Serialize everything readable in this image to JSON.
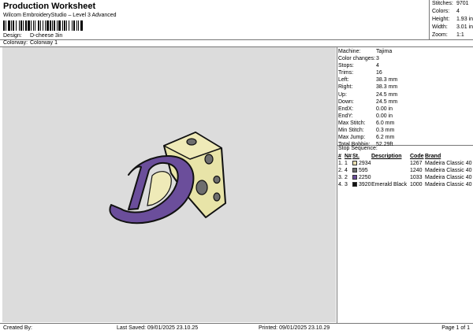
{
  "header": {
    "title": "Production Worksheet",
    "subtitle": "Wilcom EmbroideryStudio – Level 3 Advanced"
  },
  "design": [
    {
      "label": "Design:",
      "value": "D-cheese 3in"
    },
    {
      "label": "Colorway:",
      "value": "Colorway 1"
    }
  ],
  "stats": [
    {
      "label": "Stitches:",
      "value": "9701"
    },
    {
      "label": "Colors:",
      "value": "4"
    },
    {
      "label": "Height:",
      "value": "1.93 in"
    },
    {
      "label": "Width:",
      "value": "3.01 in"
    },
    {
      "label": "Zoom:",
      "value": "1:1"
    }
  ],
  "machine": [
    {
      "label": "Machine:",
      "value": "Tajima"
    },
    {
      "label": "Color changes:",
      "value": "3"
    },
    {
      "label": "Stops:",
      "value": "4"
    },
    {
      "label": "Trims:",
      "value": "16"
    },
    {
      "label": "Left:",
      "value": "38.3 mm"
    },
    {
      "label": "Right:",
      "value": "38.3 mm"
    },
    {
      "label": "Up:",
      "value": "24.5 mm"
    },
    {
      "label": "Down:",
      "value": "24.5 mm"
    },
    {
      "label": "EndX:",
      "value": "0.00 in"
    },
    {
      "label": "EndY:",
      "value": "0.00 in"
    },
    {
      "label": "Max Stitch:",
      "value": "6.0 mm"
    },
    {
      "label": "Min Stitch:",
      "value": "0.3 mm"
    },
    {
      "label": "Max Jump:",
      "value": "6.2 mm"
    },
    {
      "label": "Total Bobbin:",
      "value": "52.29ft"
    }
  ],
  "stop_sequence": {
    "title": "Stop Sequence:",
    "headers": [
      "#",
      "N#",
      "St.",
      "Description",
      "Code",
      "Brand"
    ],
    "rows": [
      {
        "num": "1.",
        "n": "1",
        "color": "#e8ddb0",
        "st": "2934",
        "desc": "",
        "code": "1267",
        "brand": "Madeira Classic 40"
      },
      {
        "num": "2.",
        "n": "4",
        "color": "#6e6e6e",
        "st": "595",
        "desc": "",
        "code": "1240",
        "brand": "Madeira Classic 40"
      },
      {
        "num": "3.",
        "n": "2",
        "color": "#6b4e9b",
        "st": "2250",
        "desc": "",
        "code": "1033",
        "brand": "Madeira Classic 40"
      },
      {
        "num": "4.",
        "n": "3",
        "color": "#111111",
        "st": "3920",
        "desc": "Emerald Black",
        "code": "1000",
        "brand": "Madeira Classic 40"
      }
    ]
  },
  "footer": {
    "created": "Created By:",
    "saved": "Last Saved: 09/01/2025 23.10.25",
    "printed": "Printed: 09/01/2025 23.10.29",
    "page": "Page 1 of 1"
  },
  "colors": {
    "design_bg": "#dcdcdc",
    "cheese": "#e8e4a8",
    "purple": "#6b4e9b",
    "holes": "#6e6e6e",
    "outline": "#111111"
  }
}
